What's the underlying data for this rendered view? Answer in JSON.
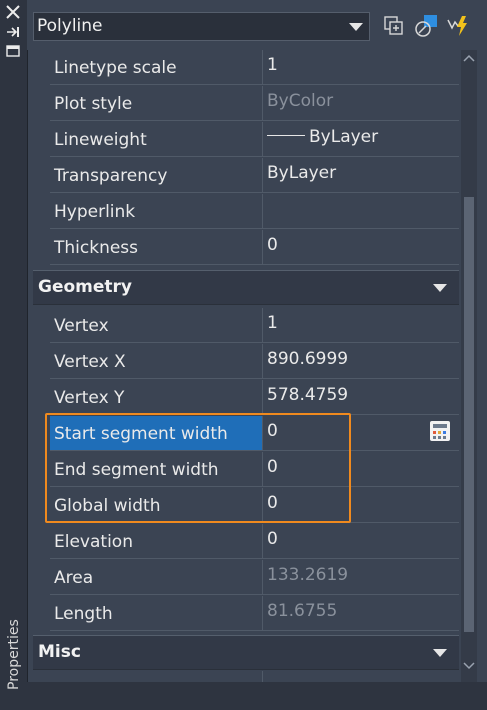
{
  "palette": {
    "title": "Properties"
  },
  "object_type": {
    "selected": "Polyline"
  },
  "sections": {
    "geometry": "Geometry",
    "misc": "Misc"
  },
  "general_rows": [
    {
      "label": "Linetype scale",
      "value": "1",
      "dim": false
    },
    {
      "label": "Plot style",
      "value": "ByColor",
      "dim": true
    },
    {
      "label": "Lineweight",
      "value": "ByLayer",
      "dim": false
    },
    {
      "label": "Transparency",
      "value": "ByLayer",
      "dim": false
    },
    {
      "label": "Hyperlink",
      "value": "",
      "dim": false
    },
    {
      "label": "Thickness",
      "value": "0",
      "dim": false
    }
  ],
  "geometry_rows": [
    {
      "label": "Vertex",
      "value": "1",
      "dim": false
    },
    {
      "label": "Vertex X",
      "value": "890.6999",
      "dim": false
    },
    {
      "label": "Vertex Y",
      "value": "578.4759",
      "dim": false
    },
    {
      "label": "Start segment width",
      "value": "0",
      "dim": false,
      "selected": true
    },
    {
      "label": "End segment width",
      "value": "0",
      "dim": false
    },
    {
      "label": "Global width",
      "value": "0",
      "dim": false
    },
    {
      "label": "Elevation",
      "value": "0",
      "dim": false
    },
    {
      "label": "Area",
      "value": "133.2619",
      "dim": true
    },
    {
      "label": "Length",
      "value": "81.6755",
      "dim": true
    }
  ],
  "icons": {
    "close": "close-icon",
    "autohide": "auto-hide-icon",
    "menu": "properties-menu-icon",
    "toggle_pickadd": "toggle-pickadd-icon",
    "select_objects": "select-objects-icon",
    "quick_select": "quick-select-icon",
    "calculator": "quick-calculator-icon"
  },
  "colors": {
    "selection": "#1f6eb8",
    "highlight_box": "#f08a1e",
    "panel_bg": "#3b4453"
  }
}
